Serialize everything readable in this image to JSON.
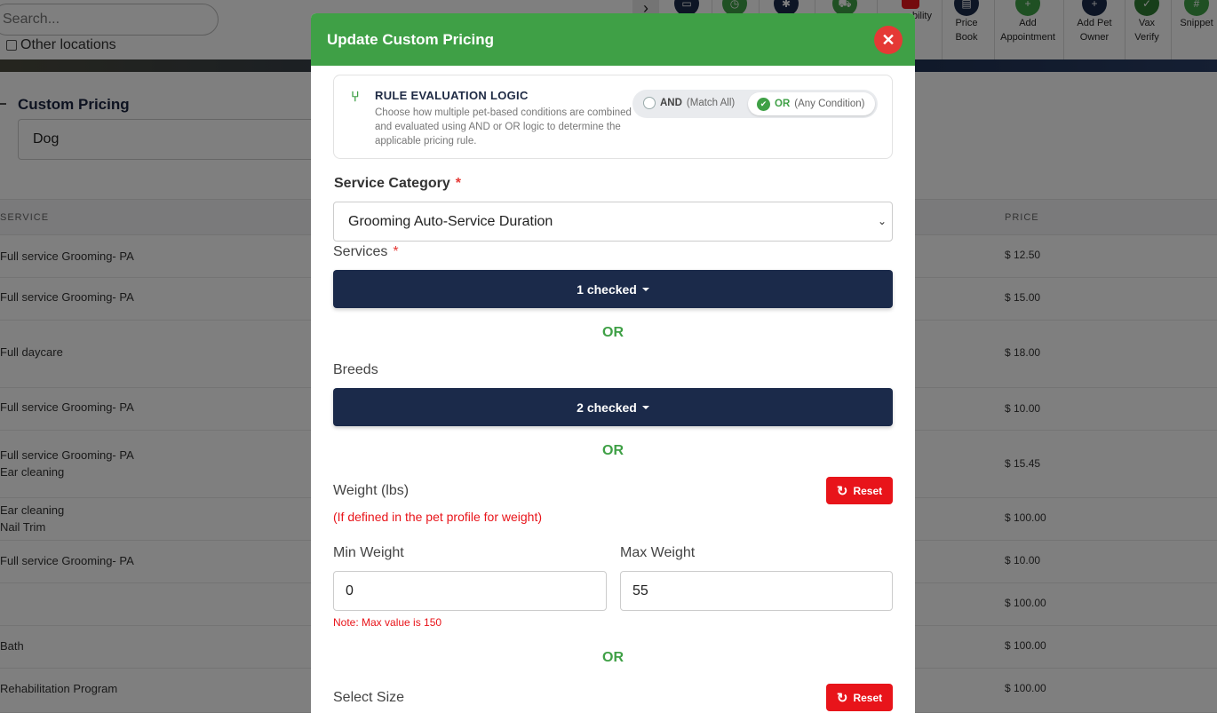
{
  "background": {
    "search_placeholder": "Search...",
    "other_locations": "Other locations",
    "custom_pricing_title": "Custom Pricing",
    "pet_type": "Dog",
    "table": {
      "headers": [
        "SERVICE",
        "PRICE"
      ],
      "rows": [
        {
          "service": "Full service Grooming- PA",
          "service2": "",
          "price": "$ 12.50"
        },
        {
          "service": "Full service Grooming- PA",
          "service2": "",
          "price": "$ 15.00"
        },
        {
          "service": "Full daycare",
          "service2": "",
          "price": "$ 18.00"
        },
        {
          "service": "Full service Grooming- PA",
          "service2": "",
          "price": "$ 10.00"
        },
        {
          "service": "Full service Grooming- PA",
          "service2": "Ear cleaning",
          "price": "$ 15.45"
        },
        {
          "service": "Ear cleaning",
          "service2": "Nail Trim",
          "price": "$ 100.00"
        },
        {
          "service": "Full service Grooming- PA",
          "service2": "",
          "price": "$ 10.00"
        },
        {
          "service": "",
          "service2": "",
          "price": "$ 100.00"
        },
        {
          "service": "Bath",
          "service2": "",
          "price": "$ 100.00"
        },
        {
          "service": "Rehabilitation Program",
          "service2": "",
          "price": "$ 100.00"
        }
      ]
    },
    "toolbar": {
      "items": [
        {
          "line1": "bility",
          "line2": ""
        },
        {
          "line1": "Price",
          "line2": "Book"
        },
        {
          "line1": "Add",
          "line2": "Appointment"
        },
        {
          "line1": "Add Pet",
          "line2": "Owner"
        },
        {
          "line1": "Vax",
          "line2": "Verify"
        },
        {
          "line1": "Snippet",
          "line2": ""
        }
      ]
    }
  },
  "modal": {
    "title": "Update Custom Pricing",
    "rule": {
      "title": "RULE EVALUATION LOGIC",
      "description": "Choose how multiple pet-based conditions are combined and evaluated using AND or OR logic to determine the applicable pricing rule.",
      "and_label": "AND",
      "and_hint": "(Match All)",
      "or_label": "OR",
      "or_hint": "(Any Condition)",
      "selected": "OR"
    },
    "service_category": {
      "label": "Service Category",
      "required": "*",
      "value": "Grooming Auto-Service Duration"
    },
    "services": {
      "label": "Services",
      "required": "*",
      "button": "1 checked"
    },
    "or_separator": "OR",
    "breeds": {
      "label": "Breeds",
      "button": "2 checked"
    },
    "weight": {
      "label": "Weight (lbs)",
      "note": "(If defined in the pet profile for weight)",
      "reset": "Reset",
      "min_label": "Min Weight",
      "min_value": "0",
      "max_label": "Max Weight",
      "max_value": "55",
      "max_note": "Note: Max value is 150"
    },
    "size": {
      "label": "Select Size",
      "reset": "Reset"
    }
  },
  "colors": {
    "header_green": "#3fa046",
    "dropdown_navy": "#1b2a4a",
    "reset_red": "#e8141a",
    "close_red": "#e53935"
  }
}
